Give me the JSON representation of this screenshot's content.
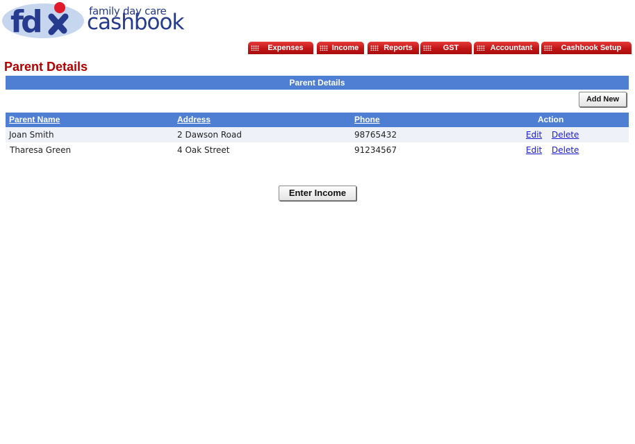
{
  "brand": {
    "logo_letters": "fdc",
    "tagline": "family day care",
    "name": "cashbook"
  },
  "nav": {
    "tabs": [
      {
        "label": "Expenses"
      },
      {
        "label": "Income"
      },
      {
        "label": "Reports"
      },
      {
        "label": "GST"
      },
      {
        "label": "Accountant"
      },
      {
        "label": "Cashbook Setup"
      }
    ]
  },
  "page": {
    "title": "Parent Details",
    "section_title": "Parent Details",
    "add_new_label": "Add New",
    "enter_income_label": "Enter Income"
  },
  "table": {
    "headers": {
      "name": "Parent Name",
      "address": "Address",
      "phone": "Phone",
      "action": "Action"
    },
    "rows": [
      {
        "name": "Joan Smith",
        "address": "2 Dawson Road",
        "phone": "98765432",
        "edit": "Edit",
        "delete": "Delete"
      },
      {
        "name": "Tharesa Green",
        "address": "4 Oak Street",
        "phone": "91234567",
        "edit": "Edit",
        "delete": "Delete"
      }
    ]
  },
  "colors": {
    "brand_blue": "#263a8e",
    "tab_red": "#c21616",
    "header_blue": "#4f7fd3",
    "title_red": "#b20000"
  }
}
